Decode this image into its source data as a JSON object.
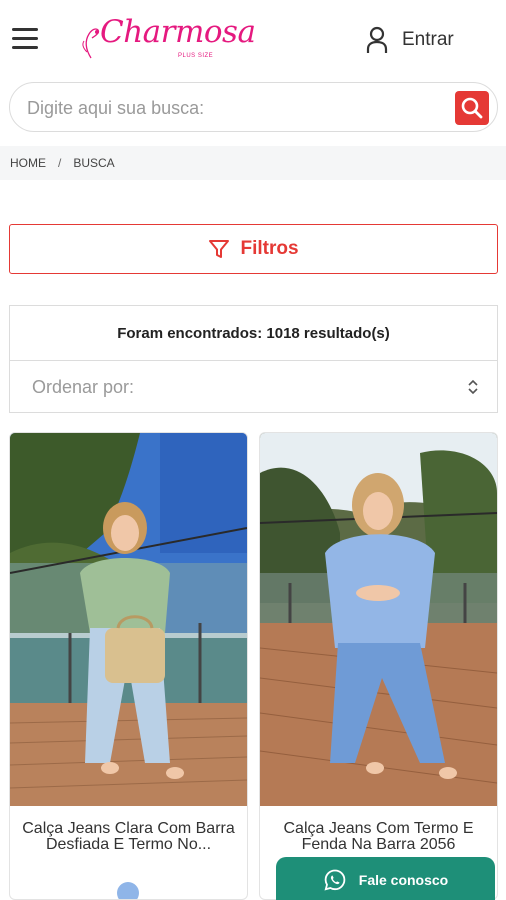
{
  "header": {
    "logo_text": "Charmosa",
    "logo_subtext": "PLUS SIZE",
    "login_label": "Entrar"
  },
  "search": {
    "placeholder": "Digite aqui sua busca:"
  },
  "breadcrumb": {
    "items": [
      "HOME",
      "BUSCA"
    ],
    "separator": "/"
  },
  "filters": {
    "label": "Filtros"
  },
  "results": {
    "count_text": "Foram encontrados: 1018 resultado(s)",
    "sort_placeholder": "Ordenar por:"
  },
  "products": [
    {
      "title": "Calça Jeans Clara Com Barra Desfiada E Termo No..."
    },
    {
      "title": "Calça Jeans Com Termo E Fenda Na Barra 2056"
    }
  ],
  "whatsapp": {
    "label": "Fale conosco"
  },
  "colors": {
    "accent": "#e53935",
    "brand": "#e5197f",
    "whatsapp": "#1e8f78"
  }
}
